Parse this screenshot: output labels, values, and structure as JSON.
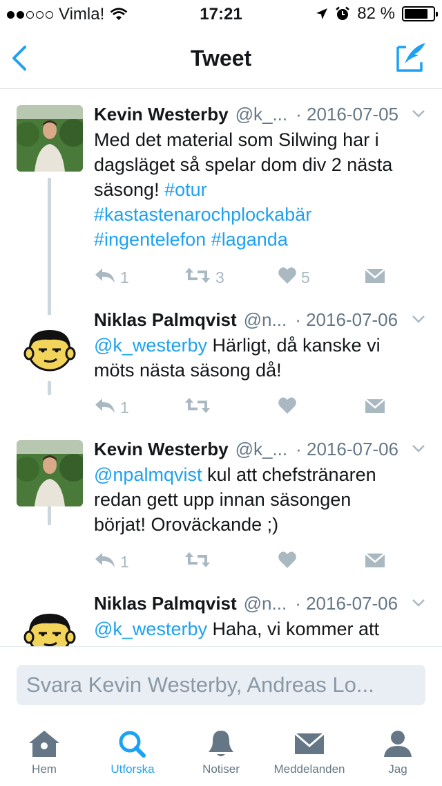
{
  "status_bar": {
    "carrier": "Vimla!",
    "time": "17:21",
    "battery": "82 %",
    "battery_level": 0.82,
    "signal_bars_filled": 2,
    "signal_bars_total": 5
  },
  "nav": {
    "title": "Tweet",
    "back_icon": "chevron-left-icon",
    "compose_icon": "compose-tweet-icon"
  },
  "colors": {
    "accent": "#1da1f2",
    "muted": "#657786",
    "icon_gray": "#aab8c2",
    "thread_line": "#ccd6dd"
  },
  "tweets": [
    {
      "name": "Kevin Westerby",
      "handle": "@k_...",
      "date": "· 2016-07-05",
      "lines": [
        [
          {
            "t": "Med det material som Silwing har i",
            "tag": false
          }
        ],
        [
          {
            "t": "dagsläget så spelar dom div 2 nästa",
            "tag": false
          }
        ],
        [
          {
            "t": "säsong! ",
            "tag": false
          },
          {
            "t": "#otur",
            "tag": true
          }
        ],
        [
          {
            "t": "#kastastenarochplockabär",
            "tag": true
          }
        ],
        [
          {
            "t": "#ingentelefon",
            "tag": true
          },
          {
            "t": " ",
            "tag": false
          },
          {
            "t": "#laganda",
            "tag": true
          }
        ]
      ],
      "reply_count": "1",
      "retweet_count": "3",
      "like_count": "5"
    },
    {
      "name": "Niklas Palmqvist",
      "handle": "@n...",
      "date": "· 2016-07-06",
      "lines": [
        [
          {
            "t": "@k_westerby",
            "tag": true
          },
          {
            "t": " Härligt, då kanske vi",
            "tag": false
          }
        ],
        [
          {
            "t": "möts nästa säsong då!",
            "tag": false
          }
        ]
      ],
      "reply_count": "1",
      "retweet_count": "",
      "like_count": ""
    },
    {
      "name": "Kevin Westerby",
      "handle": "@k_...",
      "date": "· 2016-07-06",
      "lines": [
        [
          {
            "t": "@npalmqvist",
            "tag": true
          },
          {
            "t": " kul att chefstränaren",
            "tag": false
          }
        ],
        [
          {
            "t": "redan gett upp innan säsongen",
            "tag": false
          }
        ],
        [
          {
            "t": "börjat! Oroväckande ;)",
            "tag": false
          }
        ]
      ],
      "reply_count": "1",
      "retweet_count": "",
      "like_count": ""
    },
    {
      "name": "Niklas Palmqvist",
      "handle": "@n...",
      "date": "· 2016-07-06",
      "lines": [
        [
          {
            "t": "@k_westerby",
            "tag": true
          },
          {
            "t": " Haha, vi kommer att",
            "tag": false
          }
        ]
      ],
      "reply_count": "",
      "retweet_count": "",
      "like_count": ""
    }
  ],
  "reply_box": {
    "placeholder": "Svara Kevin Westerby, Andreas Lo..."
  },
  "tab_bar": [
    {
      "label": "Hem",
      "icon": "home-icon",
      "active": false
    },
    {
      "label": "Utforska",
      "icon": "search-icon",
      "active": true
    },
    {
      "label": "Notiser",
      "icon": "bell-icon",
      "active": false
    },
    {
      "label": "Meddelanden",
      "icon": "envelope-icon",
      "active": false
    },
    {
      "label": "Jag",
      "icon": "profile-icon",
      "active": false
    }
  ]
}
